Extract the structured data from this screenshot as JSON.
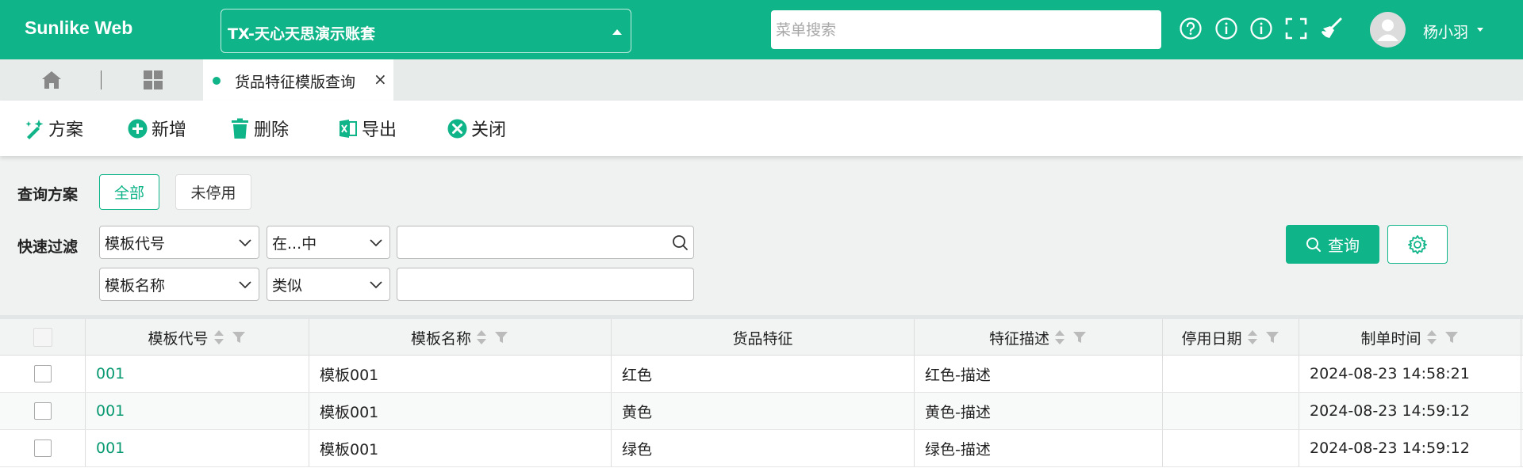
{
  "header": {
    "brand": "Sunlike Web",
    "account": "TX-天心天思演示账套",
    "search_placeholder": "菜单搜索",
    "icons": [
      "help-circle-icon",
      "info-icon",
      "info-icon",
      "fullscreen-icon",
      "broom-icon"
    ],
    "user_name": "杨小羽"
  },
  "tabs": {
    "home_icon": "home-icon",
    "apps_icon": "grid-icon",
    "active_label": "货品特征模版查询",
    "close_glyph": "×"
  },
  "toolbar": {
    "plan": "方案",
    "add": "新增",
    "delete": "删除",
    "export": "导出",
    "close": "关闭"
  },
  "filters": {
    "scheme_label": "查询方案",
    "scheme_all": "全部",
    "scheme_active": "未停用",
    "quick_label": "快速过滤",
    "row1": {
      "field": "模板代号",
      "operator": "在...中",
      "value": ""
    },
    "row2": {
      "field": "模板名称",
      "operator": "类似",
      "value": ""
    },
    "query_button": "查询"
  },
  "table": {
    "columns": [
      "模板代号",
      "模板名称",
      "货品特征",
      "特征描述",
      "停用日期",
      "制单时间"
    ],
    "rows": [
      {
        "code": "001",
        "name": "模板001",
        "feature": "红色",
        "desc": "红色-描述",
        "stop_date": "",
        "created": "2024-08-23 14:58:21"
      },
      {
        "code": "001",
        "name": "模板001",
        "feature": "黄色",
        "desc": "黄色-描述",
        "stop_date": "",
        "created": "2024-08-23 14:59:12"
      },
      {
        "code": "001",
        "name": "模板001",
        "feature": "绿色",
        "desc": "绿色-描述",
        "stop_date": "",
        "created": "2024-08-23 14:59:12"
      }
    ]
  },
  "colors": {
    "accent": "#0fb488",
    "link": "#0a9a72"
  }
}
